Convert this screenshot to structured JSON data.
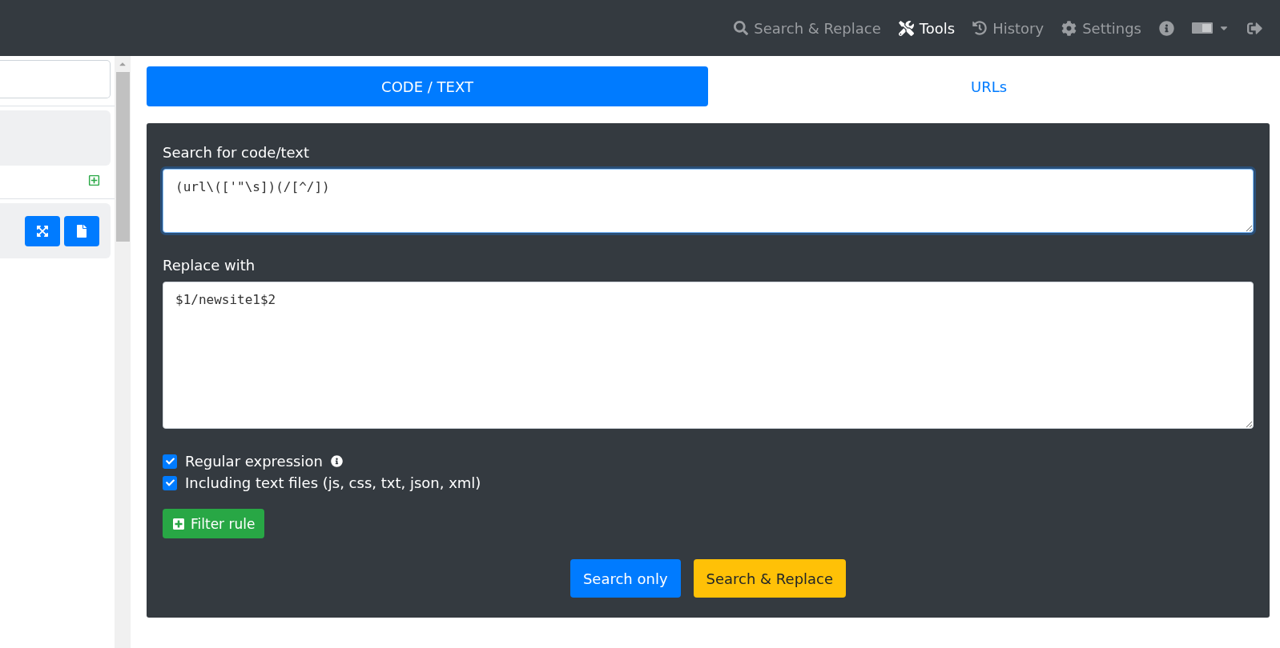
{
  "navbar": {
    "items": [
      {
        "kind": "search",
        "label": "Search & Replace",
        "selected": false
      },
      {
        "kind": "tools",
        "label": "Tools",
        "selected": true
      },
      {
        "kind": "history",
        "label": "History",
        "selected": false
      },
      {
        "kind": "settings",
        "label": "Settings",
        "selected": false
      },
      {
        "kind": "info",
        "selected": false
      },
      {
        "kind": "language",
        "selected": false
      },
      {
        "kind": "logout",
        "selected": false
      }
    ]
  },
  "tabs": [
    {
      "label": "CODE / TEXT",
      "selected": true
    },
    {
      "label": "URLs",
      "selected": false
    }
  ],
  "form": {
    "search_label": "Search for code/text",
    "search_value": "(url\\(['\"\\s])(/[^/])",
    "replace_label": "Replace with",
    "replace_value": "$1/newsite1$2",
    "options": [
      {
        "label": "Regular expression",
        "checked": true,
        "info": true
      },
      {
        "label": "Including text files (js, css, txt, json, xml)",
        "checked": true,
        "info": false
      }
    ],
    "filter_button": "Filter rule",
    "buttons": [
      {
        "kind": "primary",
        "label": "Search only"
      },
      {
        "kind": "warning",
        "label": "Search & Replace"
      }
    ]
  }
}
